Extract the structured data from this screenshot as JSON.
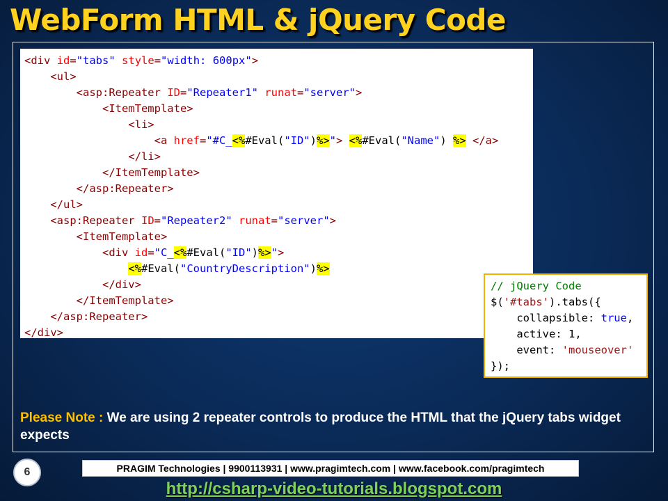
{
  "slide": {
    "title": "WebForm HTML & jQuery Code",
    "page_number": "6"
  },
  "html_code": {
    "lines": [
      [
        {
          "t": "tag",
          "s": "<div "
        },
        {
          "t": "attr",
          "s": "id"
        },
        {
          "t": "tag",
          "s": "="
        },
        {
          "t": "val",
          "s": "\"tabs\""
        },
        {
          "t": "tag",
          "s": " "
        },
        {
          "t": "attr",
          "s": "style"
        },
        {
          "t": "tag",
          "s": "="
        },
        {
          "t": "val",
          "s": "\"width: 600px\""
        },
        {
          "t": "tag",
          "s": ">"
        }
      ],
      [
        {
          "t": "txt",
          "s": "    "
        },
        {
          "t": "tag",
          "s": "<ul>"
        }
      ],
      [
        {
          "t": "txt",
          "s": "        "
        },
        {
          "t": "tag",
          "s": "<asp:Repeater "
        },
        {
          "t": "attr",
          "s": "ID"
        },
        {
          "t": "tag",
          "s": "="
        },
        {
          "t": "val",
          "s": "\"Repeater1\""
        },
        {
          "t": "tag",
          "s": " "
        },
        {
          "t": "attr",
          "s": "runat"
        },
        {
          "t": "tag",
          "s": "="
        },
        {
          "t": "val",
          "s": "\"server\""
        },
        {
          "t": "tag",
          "s": ">"
        }
      ],
      [
        {
          "t": "txt",
          "s": "            "
        },
        {
          "t": "tag",
          "s": "<ItemTemplate>"
        }
      ],
      [
        {
          "t": "txt",
          "s": "                "
        },
        {
          "t": "tag",
          "s": "<li>"
        }
      ],
      [
        {
          "t": "txt",
          "s": "                    "
        },
        {
          "t": "tag",
          "s": "<a "
        },
        {
          "t": "attr",
          "s": "href"
        },
        {
          "t": "tag",
          "s": "="
        },
        {
          "t": "val",
          "s": "\"#C_"
        },
        {
          "t": "hl",
          "s": "<%"
        },
        {
          "t": "txt",
          "s": "#Eval("
        },
        {
          "t": "val",
          "s": "\"ID\""
        },
        {
          "t": "txt",
          "s": ")"
        },
        {
          "t": "hl",
          "s": "%>"
        },
        {
          "t": "val",
          "s": "\""
        },
        {
          "t": "tag",
          "s": "> "
        },
        {
          "t": "hl",
          "s": "<%"
        },
        {
          "t": "txt",
          "s": "#Eval("
        },
        {
          "t": "val",
          "s": "\"Name\""
        },
        {
          "t": "txt",
          "s": ") "
        },
        {
          "t": "hl",
          "s": "%>"
        },
        {
          "t": "tag",
          "s": " </a>"
        }
      ],
      [
        {
          "t": "txt",
          "s": "                "
        },
        {
          "t": "tag",
          "s": "</li>"
        }
      ],
      [
        {
          "t": "txt",
          "s": "            "
        },
        {
          "t": "tag",
          "s": "</ItemTemplate>"
        }
      ],
      [
        {
          "t": "txt",
          "s": "        "
        },
        {
          "t": "tag",
          "s": "</asp:Repeater>"
        }
      ],
      [
        {
          "t": "txt",
          "s": "    "
        },
        {
          "t": "tag",
          "s": "</ul>"
        }
      ],
      [
        {
          "t": "txt",
          "s": "    "
        },
        {
          "t": "tag",
          "s": "<asp:Repeater "
        },
        {
          "t": "attr",
          "s": "ID"
        },
        {
          "t": "tag",
          "s": "="
        },
        {
          "t": "val",
          "s": "\"Repeater2\""
        },
        {
          "t": "tag",
          "s": " "
        },
        {
          "t": "attr",
          "s": "runat"
        },
        {
          "t": "tag",
          "s": "="
        },
        {
          "t": "val",
          "s": "\"server\""
        },
        {
          "t": "tag",
          "s": ">"
        }
      ],
      [
        {
          "t": "txt",
          "s": "        "
        },
        {
          "t": "tag",
          "s": "<ItemTemplate>"
        }
      ],
      [
        {
          "t": "txt",
          "s": "            "
        },
        {
          "t": "tag",
          "s": "<div "
        },
        {
          "t": "attr",
          "s": "id"
        },
        {
          "t": "tag",
          "s": "="
        },
        {
          "t": "val",
          "s": "\"C_"
        },
        {
          "t": "hl",
          "s": "<%"
        },
        {
          "t": "txt",
          "s": "#Eval("
        },
        {
          "t": "val",
          "s": "\"ID\""
        },
        {
          "t": "txt",
          "s": ")"
        },
        {
          "t": "hl",
          "s": "%>"
        },
        {
          "t": "val",
          "s": "\""
        },
        {
          "t": "tag",
          "s": ">"
        }
      ],
      [
        {
          "t": "txt",
          "s": "                "
        },
        {
          "t": "hl",
          "s": "<%"
        },
        {
          "t": "txt",
          "s": "#Eval("
        },
        {
          "t": "val",
          "s": "\"CountryDescription\""
        },
        {
          "t": "txt",
          "s": ")"
        },
        {
          "t": "hl",
          "s": "%>"
        }
      ],
      [
        {
          "t": "txt",
          "s": "            "
        },
        {
          "t": "tag",
          "s": "</div>"
        }
      ],
      [
        {
          "t": "txt",
          "s": "        "
        },
        {
          "t": "tag",
          "s": "</ItemTemplate>"
        }
      ],
      [
        {
          "t": "txt",
          "s": "    "
        },
        {
          "t": "tag",
          "s": "</asp:Repeater>"
        }
      ],
      [
        {
          "t": "tag",
          "s": "</div>"
        }
      ]
    ]
  },
  "jquery_code": {
    "lines": [
      [
        {
          "t": "comment",
          "s": "// jQuery Code"
        }
      ],
      [
        {
          "t": "txt",
          "s": "$("
        },
        {
          "t": "str",
          "s": "'#tabs'"
        },
        {
          "t": "txt",
          "s": ").tabs({"
        }
      ],
      [
        {
          "t": "txt",
          "s": "    collapsible: "
        },
        {
          "t": "kw",
          "s": "true"
        },
        {
          "t": "txt",
          "s": ","
        }
      ],
      [
        {
          "t": "txt",
          "s": "    active: 1,"
        }
      ],
      [
        {
          "t": "txt",
          "s": "    event: "
        },
        {
          "t": "str",
          "s": "'mouseover'"
        }
      ],
      [
        {
          "t": "txt",
          "s": "});"
        }
      ]
    ]
  },
  "note": {
    "label": "Please Note : ",
    "text": "We are using 2 repeater controls to produce the HTML that the jQuery tabs widget expects"
  },
  "footer": {
    "company_info": "PRAGIM Technologies | 9900113931 | www.pragimtech.com | www.facebook.com/pragimtech",
    "blog_url": "http://csharp-video-tutorials.blogspot.com"
  },
  "colors": {
    "title": "#ffd21f",
    "note_label": "#ffc000",
    "link": "#7dd35a",
    "highlight": "#ffff00",
    "jquery_border": "#f0b400"
  }
}
